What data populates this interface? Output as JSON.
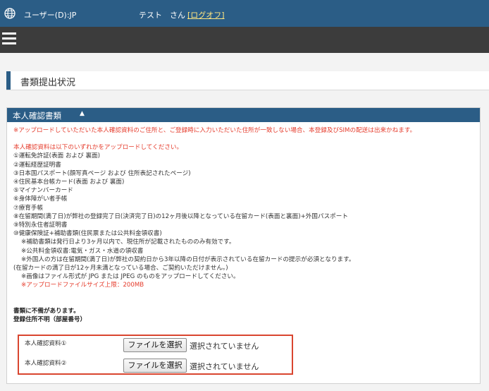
{
  "header": {
    "user_label": "ユーザー(D):JP",
    "greeting": "テスト　さん",
    "logout_label": "[ログオフ]"
  },
  "page": {
    "title": "書類提出状況"
  },
  "panel": {
    "title": "本人確認書類",
    "toggle": "▲",
    "notice": "※アップロードしていただいた本人確認資料のご住所と、ご登録時に入力いただいた住所が一致しない場合、本登録及びSIMの配送は出来かねます。",
    "intro": "本人確認資料は以下のいずれかをアップロードしてください。",
    "documents": [
      "①運転免許証(表面 および 裏面)",
      "②運転経歴証明書",
      "③日本国パスポート(顔写真ページ および 住所表記されたページ)",
      "④住民基本台帳カード(表面 および 裏面)",
      "⑤マイナンバーカード",
      "⑥身体障がい者手帳",
      "⑦療育手帳",
      "⑧在留期間(満了日)が弊社の登録完了日(決済完了日)の12ヶ月後以降となっている在留カード(表面と裏面)+外国パスポート",
      "⑨特別永住者証明書",
      "⑩健康保険証+補助書類(住民票または公共料金領収書)"
    ],
    "notes": [
      "※補助書類は発行日より3ヶ月以内で、現住所が記載されたもののみ有効です。",
      "※公共料金領収書:電気・ガス・水道の領収書",
      "※外国人の方は在留期間(満了日)が弊社の契約日から3年以降の日付が表示されている在留カードの提示が必須となります。"
    ],
    "note_residence": "(在留カードの満了日が12ヶ月未満となっている場合、ご契約いただけません。)",
    "note_format": "※画像はファイル形式が JPG または JPEG のものをアップロードしてください。",
    "note_size": "※アップロードファイルサイズ上限：200MB",
    "status_line1": "書類に不備があります。",
    "status_line2": "登録住所不明（部屋番号）"
  },
  "uploads": [
    {
      "label": "本人確認資料①",
      "button": "ファイルを選択",
      "status": "選択されていません"
    },
    {
      "label": "本人確認資料②",
      "button": "ファイルを選択",
      "status": "選択されていません"
    }
  ],
  "colors": {
    "header_blue": "#2b5d86",
    "nav_dark": "#3c3c3c",
    "alert_red": "#e53a2a",
    "highlight_border": "#d9452f"
  },
  "icons": {
    "globe": "globe-icon",
    "menu": "hamburger-menu-icon"
  }
}
